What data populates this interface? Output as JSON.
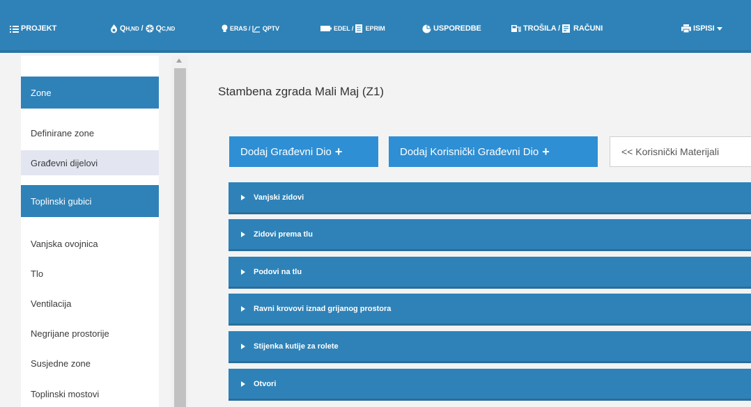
{
  "nav": {
    "projekt": "PROJEKT",
    "q_main": "Q",
    "q_h_sub": "H,ND",
    "q_sep": " / ",
    "q_c_sub": "C,ND",
    "eras": "ERAS / ",
    "qptv": "QPTV",
    "edel": "EDEL / ",
    "eprim": "EPRIM",
    "usporedbe": "USPOREDBE",
    "trosila": "TROŠILA / ",
    "racuni": "RAČUNI",
    "ispisi": "ISPISI"
  },
  "sidebar": {
    "zone_header": "Zone",
    "zone_items": [
      "Definirane zone",
      "Građevni dijelovi"
    ],
    "gubici_header": "Toplinski gubici",
    "gubici_items": [
      "Vanjska ovojnica",
      "Tlo",
      "Ventilacija",
      "Negrijane prostorije",
      "Susjedne zone",
      "Toplinski mostovi"
    ]
  },
  "main": {
    "title": "Stambena zgrada Mali Maj (Z1)",
    "btn_add_dio": "Dodaj Građevni Dio",
    "btn_add_korisnicki": "Dodaj Korisnički Građevni Dio",
    "btn_materijali": "<< Korisnički Materijali",
    "panels": [
      "Vanjski zidovi",
      "Zidovi prema tlu",
      "Podovi na tlu",
      "Ravni krovovi iznad grijanog prostora",
      "Stijenka kutije za rolete",
      "Otvori"
    ]
  },
  "colors": {
    "nav_bg": "#2e82b8",
    "button_blue": "#2e8fd4",
    "active_item": "#e3e6f1"
  }
}
